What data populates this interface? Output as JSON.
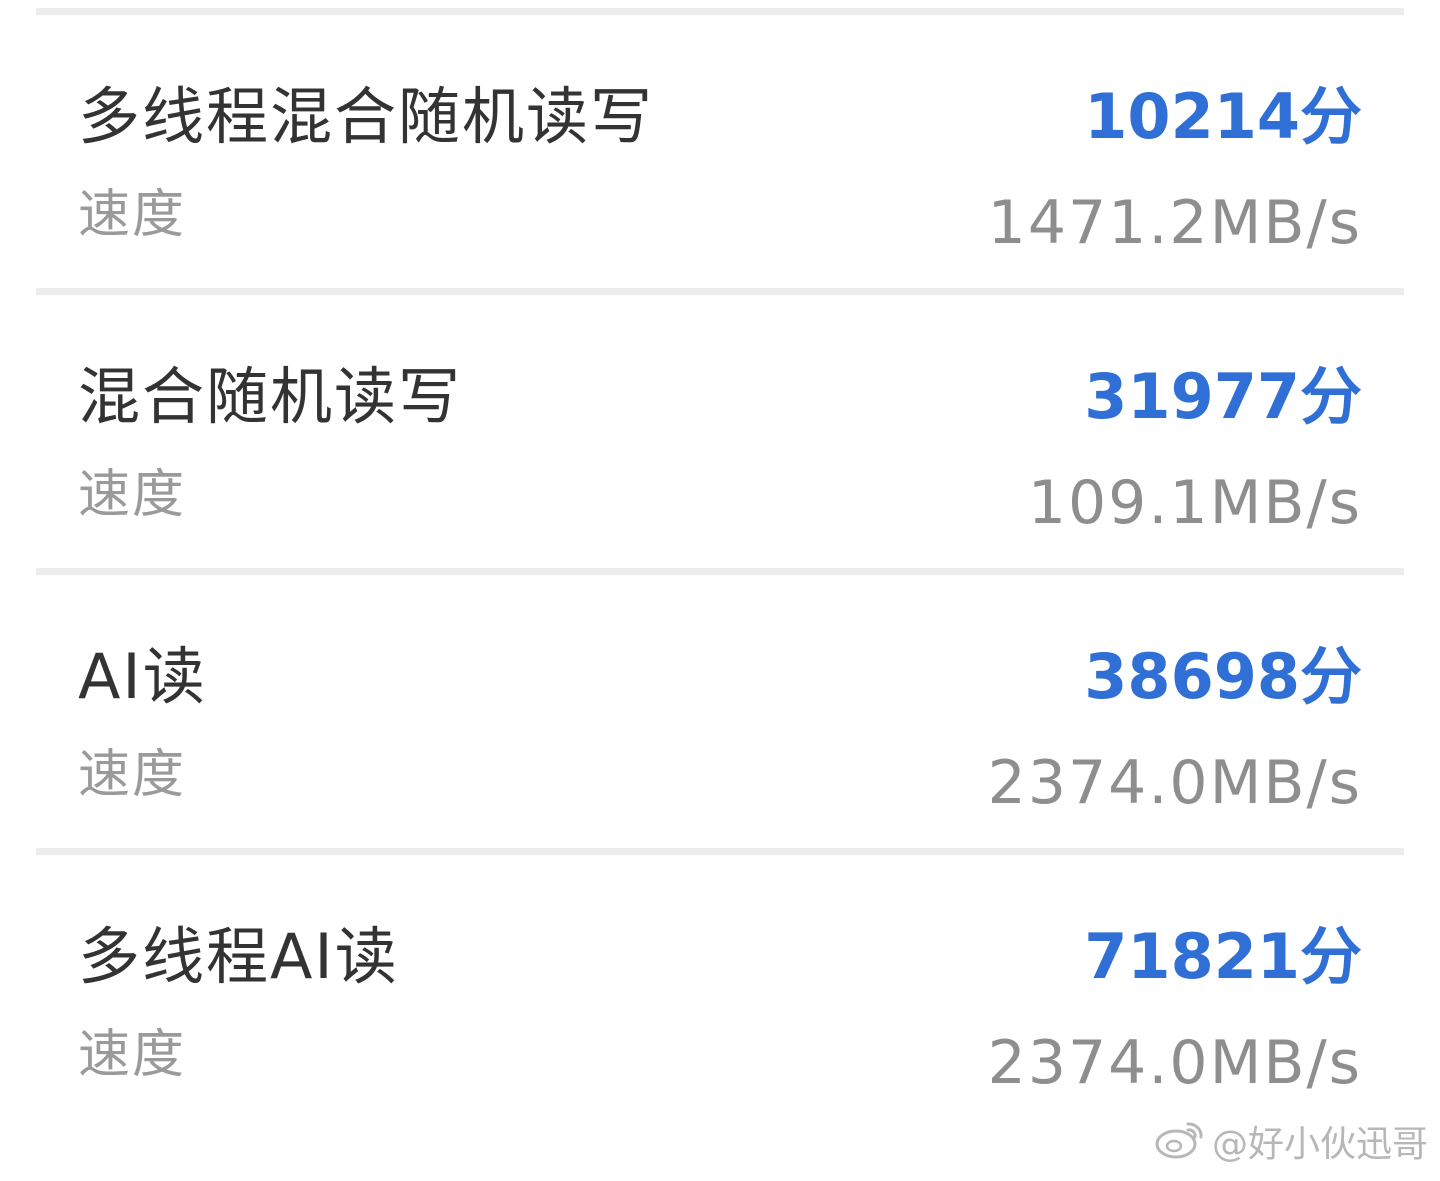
{
  "rows": [
    {
      "title": "多线程混合随机读写",
      "score": "10214分",
      "speed_label": "速度",
      "speed_value": "1471.2MB/s"
    },
    {
      "title": "混合随机读写",
      "score": "31977分",
      "speed_label": "速度",
      "speed_value": "109.1MB/s"
    },
    {
      "title": "AI读",
      "score": "38698分",
      "speed_label": "速度",
      "speed_value": "2374.0MB/s"
    },
    {
      "title": "多线程AI读",
      "score": "71821分",
      "speed_label": "速度",
      "speed_value": "2374.0MB/s"
    }
  ],
  "watermark": {
    "text": "@好小伙迅哥",
    "icon": "weibo-logo-icon"
  },
  "colors": {
    "score": "#2f6fd6",
    "title": "#333333",
    "secondary": "#8e8e8e",
    "divider": "#ececec"
  }
}
